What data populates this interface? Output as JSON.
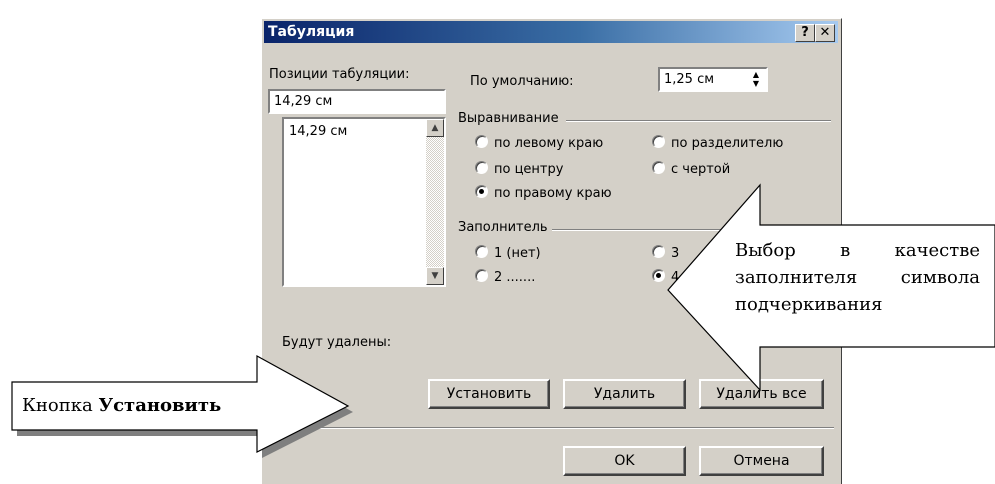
{
  "dialog": {
    "title": "Табуляция",
    "help_button": "?",
    "close_button": "✕",
    "tab_positions_label": "Позиции табуляции:",
    "tab_position_value": "14,29 см",
    "tab_list": [
      "14,29 см"
    ],
    "default_label": "По умолчанию:",
    "default_value": "1,25 см",
    "alignment_group": "Выравнивание",
    "alignment_options": {
      "left": "по левому краю",
      "decimal": "по разделителю",
      "center": "по центру",
      "bar": "с чертой",
      "right": "по правому краю"
    },
    "alignment_selected": "right",
    "leader_group": "Заполнитель",
    "leader_options": {
      "none": "1 (нет)",
      "dots": "2 .......",
      "dashes": "3",
      "underline": "4"
    },
    "leader_selected": "underline",
    "to_be_cleared_label": "Будут удалены:",
    "set_button": "Установить",
    "clear_button": "Удалить",
    "clear_all_button": "Удалить все",
    "ok_button": "OK",
    "cancel_button": "Отмена"
  },
  "callouts": {
    "set_button_note_prefix": "Кнопка ",
    "set_button_note_bold": "Установить",
    "leader_note_line1": "Выбор в качестве",
    "leader_note_line2": "заполнителя символа",
    "leader_note_line3": "подчеркивания"
  }
}
